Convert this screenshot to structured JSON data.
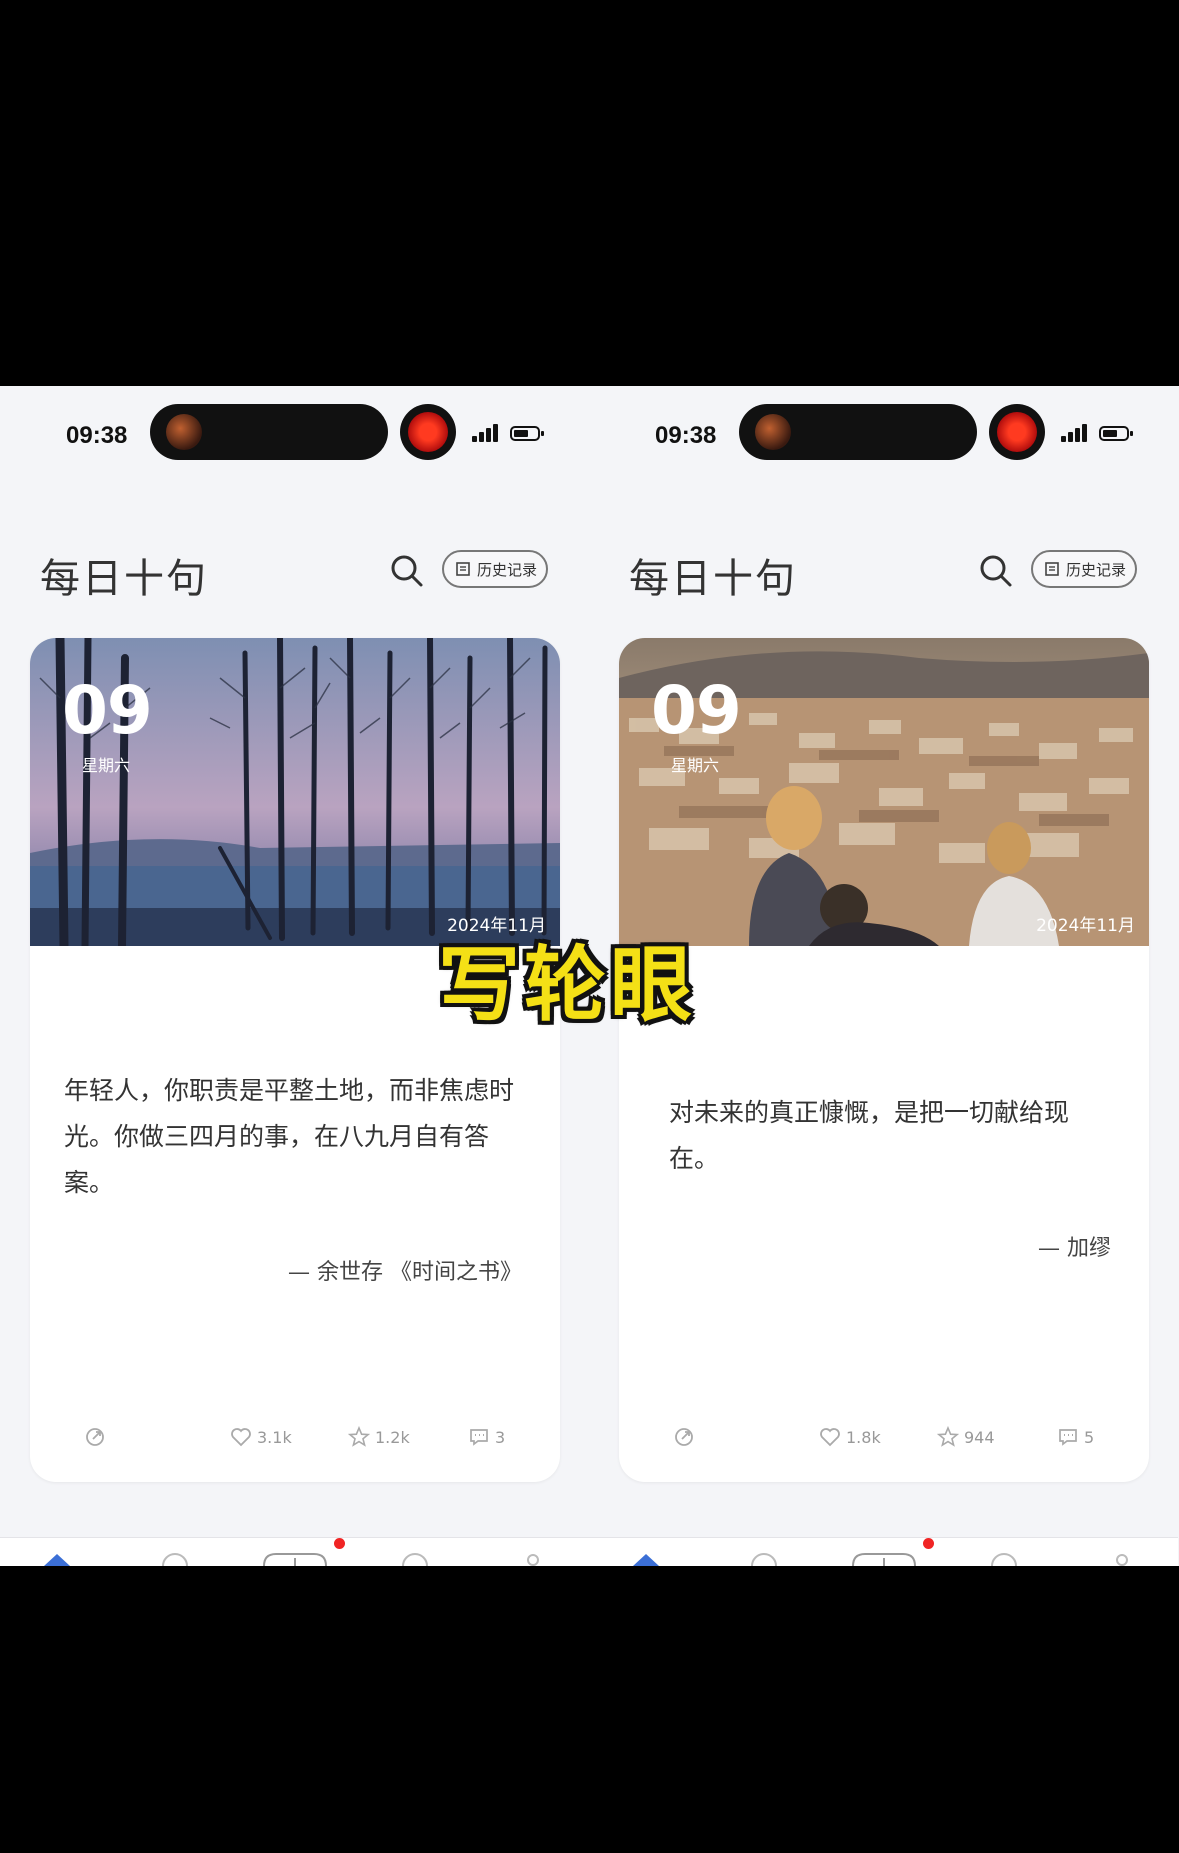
{
  "status_bar": {
    "time": "09:38"
  },
  "app": {
    "title": "每日十句",
    "history_label": "历史记录"
  },
  "cards": [
    {
      "day": "09",
      "weekday": "星期六",
      "month": "2024年11月",
      "quote": "年轻人，你职责是平整土地，而非焦虑时光。你做三四月的事，在八九月自有答案。",
      "author": "— 余世存 《时间之书》",
      "likes": "3.1k",
      "favorites": "1.2k",
      "comments": "3"
    },
    {
      "day": "09",
      "weekday": "星期六",
      "month": "2024年11月",
      "quote": "对未来的真正慷慨，是把一切献给现在。",
      "author": "— 加缪",
      "likes": "1.8k",
      "favorites": "944",
      "comments": "5"
    }
  ],
  "overlay_caption": "写轮眼",
  "icons": [
    "search-icon",
    "history-icon",
    "share-icon",
    "heart-icon",
    "star-icon",
    "comment-icon",
    "home-icon"
  ],
  "colors": {
    "accent_red": "#f02424",
    "caption_yellow": "#f4e016"
  }
}
